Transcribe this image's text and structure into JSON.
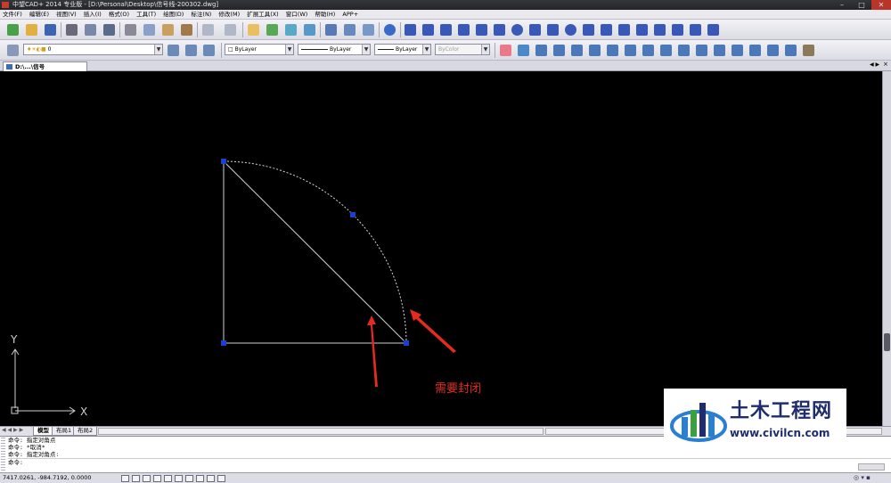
{
  "window": {
    "title": "中望CAD+ 2014 专业版 - [D:\\Personal\\Desktop\\信号线-200302.dwg]",
    "minimize": "–",
    "maximize": "□",
    "close": "✕"
  },
  "menu": [
    "文件(F)",
    "编辑(E)",
    "视图(V)",
    "插入(I)",
    "格式(O)",
    "工具(T)",
    "绘图(D)",
    "标注(N)",
    "修改(M)",
    "扩展工具(X)",
    "窗口(W)",
    "帮助(H)",
    "APP+"
  ],
  "properties_bar": {
    "layer_value": "0",
    "color_value": "ByLayer",
    "linetype_value": "ByLayer",
    "lineweight_value": "ByLayer",
    "plotstyle_value": "ByColor"
  },
  "document_tab": {
    "label": "D:\\...\\信号线-200302.dwg"
  },
  "canvas": {
    "annotation_text": "需要封闭",
    "axis_y_label": "Y",
    "axis_x_label": "X",
    "background": "#000000",
    "geometry_color": "#ffffff",
    "grip_color": "#1a3fd6",
    "arrow_color": "#e52b1f"
  },
  "layout_tabs": [
    "模型",
    "布局1",
    "布局2"
  ],
  "command_history": [
    "命令:  指定对角点",
    "命令:  *取消*",
    "命令:  指定对角点:",
    "命令:"
  ],
  "status": {
    "coordinates": "7417.0261, -984.7192, 0.0000"
  },
  "watermark": {
    "brand": "土木工程网",
    "url": "www.civilcn.com",
    "brand_color": "#1f2d6e"
  }
}
